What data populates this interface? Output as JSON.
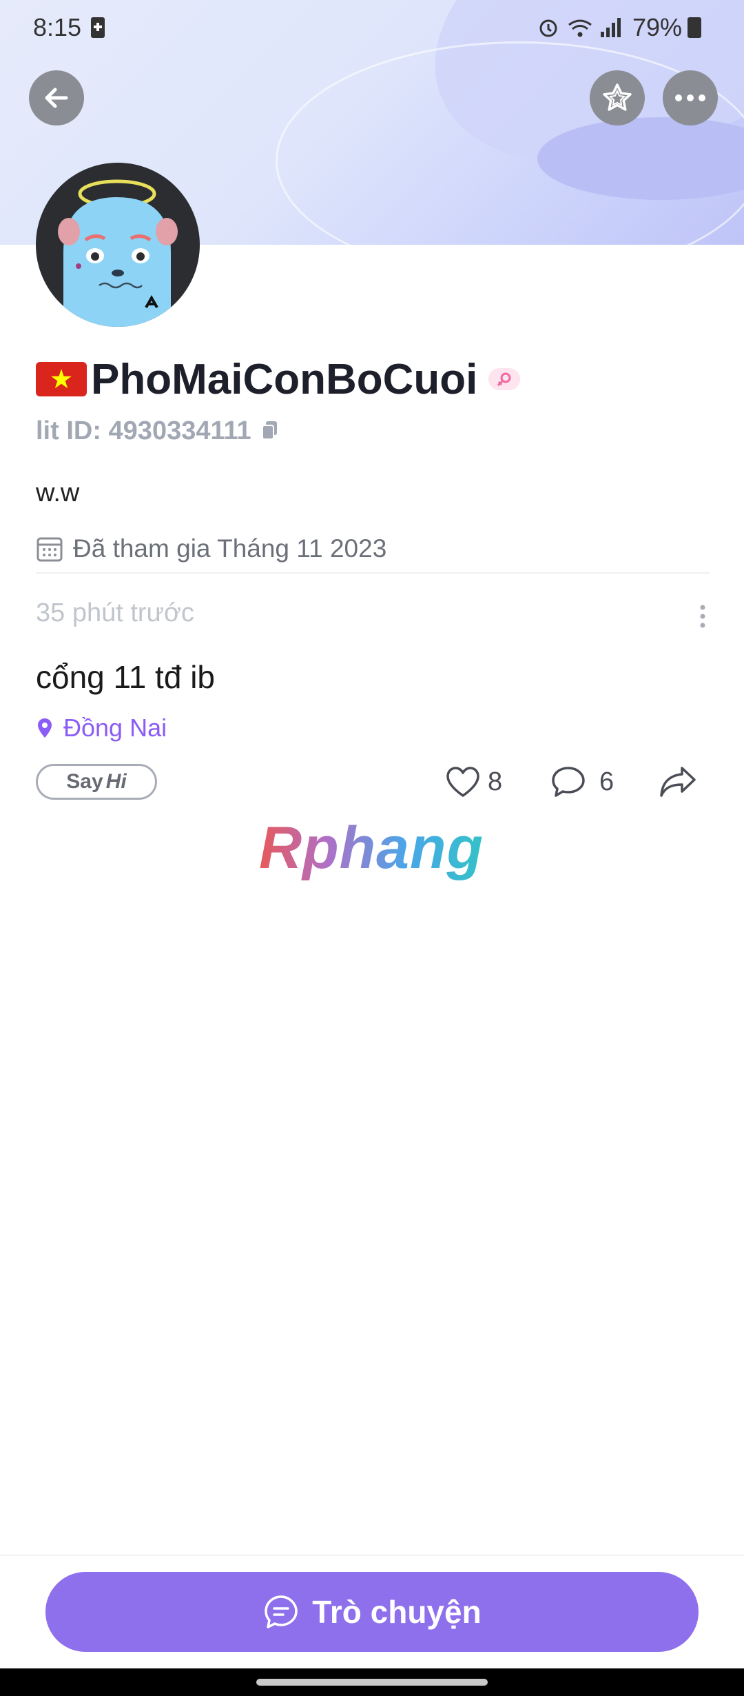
{
  "status_bar": {
    "time": "8:15",
    "battery": "79%"
  },
  "profile": {
    "username": "PhoMaiConBoCuoi",
    "lit_id": "lit ID: 4930334111",
    "bio": "w.w",
    "joined": "Đã tham gia Tháng 11 2023"
  },
  "post": {
    "time": "35 phút trước",
    "text": "cổng 11 tđ ib",
    "location": "Đồng Nai",
    "say_label": "Say",
    "hi_label": "Hi",
    "likes": "8",
    "comments": "6"
  },
  "watermark": "Rphang",
  "chat_button": {
    "label": "Trò chuyện"
  },
  "colors": {
    "accent": "#8f70ec",
    "location": "#8b5cf6",
    "flag_red": "#da251d",
    "flag_star": "#ffff00"
  },
  "icons": [
    "back-arrow-icon",
    "star-icon",
    "more-icon",
    "copy-icon",
    "calendar-icon",
    "location-pin-icon",
    "heart-icon",
    "comment-icon",
    "share-icon",
    "chat-icon"
  ]
}
